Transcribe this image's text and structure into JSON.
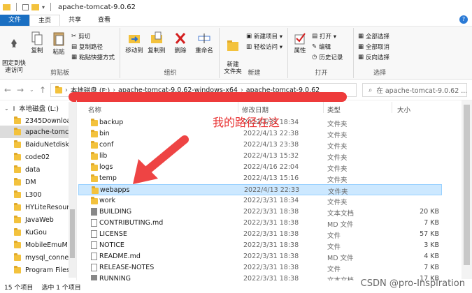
{
  "window": {
    "title": "apache-tomcat-9.0.62"
  },
  "menu": {
    "tabs": [
      "文件",
      "主页",
      "共享",
      "查看"
    ]
  },
  "ribbon": {
    "clipboard": {
      "pin": "固定到快\n速访问",
      "copy": "复制",
      "paste": "粘贴",
      "cut": "剪切",
      "copy_path": "复制路径",
      "paste_shortcut": "粘贴快捷方式",
      "label": "剪贴板"
    },
    "organize": {
      "move_to": "移动到",
      "copy_to": "复制到",
      "delete": "删除",
      "rename": "重命名",
      "label": "组织"
    },
    "new": {
      "new_folder": "新建\n文件夹",
      "new_item": "新建项目 ▾",
      "easy_access": "轻松访问 ▾",
      "label": "新建"
    },
    "open": {
      "properties": "属性",
      "open": "打开 ▾",
      "edit": "编辑",
      "history": "历史记录",
      "label": "打开"
    },
    "select": {
      "select_all": "全部选择",
      "select_none": "全部取消",
      "invert": "反向选择",
      "label": "选择"
    }
  },
  "address": {
    "crumbs": [
      "本地磁盘 (F:)",
      "apache-tomcat-9.0.62-windows-x64",
      "apache-tomcat-9.0.62"
    ],
    "search_placeholder": "在 apache-tomcat-9.0.62 ..."
  },
  "sidebar": {
    "drive": "本地磁盘 (L:)",
    "items": [
      "2345Downloa",
      "apache-tomc",
      "BaiduNetdisk",
      "code02",
      "data",
      "DM",
      "L300",
      "HYLiteResour",
      "JavaWeb",
      "KuGou",
      "MobileEmuM",
      "mysql_connec",
      "Program Files"
    ]
  },
  "columns": {
    "name": "名称",
    "date": "修改日期",
    "type": "类型",
    "size": "大小"
  },
  "files": [
    {
      "name": "backup",
      "date": "2022/3/31 18:34",
      "type": "文件夹",
      "size": "",
      "kind": "folder"
    },
    {
      "name": "bin",
      "date": "2022/4/13 22:38",
      "type": "文件夹",
      "size": "",
      "kind": "folder"
    },
    {
      "name": "conf",
      "date": "2022/4/13 23:38",
      "type": "文件夹",
      "size": "",
      "kind": "folder"
    },
    {
      "name": "lib",
      "date": "2022/4/13 15:32",
      "type": "文件夹",
      "size": "",
      "kind": "folder"
    },
    {
      "name": "logs",
      "date": "2022/4/16 22:04",
      "type": "文件夹",
      "size": "",
      "kind": "folder"
    },
    {
      "name": "temp",
      "date": "2022/4/13 15:16",
      "type": "文件夹",
      "size": "",
      "kind": "folder"
    },
    {
      "name": "webapps",
      "date": "2022/4/13 22:33",
      "type": "文件夹",
      "size": "",
      "kind": "folder"
    },
    {
      "name": "work",
      "date": "2022/3/31 18:34",
      "type": "文件夹",
      "size": "",
      "kind": "folder"
    },
    {
      "name": "BUILDING",
      "date": "2022/3/31 18:38",
      "type": "文本文档",
      "size": "20 KB",
      "kind": "file-dark"
    },
    {
      "name": "CONTRIBUTING.md",
      "date": "2022/3/31 18:38",
      "type": "MD 文件",
      "size": "7 KB",
      "kind": "file"
    },
    {
      "name": "LICENSE",
      "date": "2022/3/31 18:38",
      "type": "文件",
      "size": "57 KB",
      "kind": "file"
    },
    {
      "name": "NOTICE",
      "date": "2022/3/31 18:38",
      "type": "文件",
      "size": "3 KB",
      "kind": "file"
    },
    {
      "name": "README.md",
      "date": "2022/3/31 18:38",
      "type": "MD 文件",
      "size": "4 KB",
      "kind": "file"
    },
    {
      "name": "RELEASE-NOTES",
      "date": "2022/3/31 18:38",
      "type": "文件",
      "size": "7 KB",
      "kind": "file"
    },
    {
      "name": "RUNNING",
      "date": "2022/3/31 18:38",
      "type": "文本文档",
      "size": "17 KB",
      "kind": "file-dark"
    }
  ],
  "status": {
    "count": "15 个项目",
    "selected": "选中 1 个项目"
  },
  "annotation": "我的路径在这",
  "watermark": "CSDN @pro-Inspiration",
  "colors": {
    "annotation": "#e83232",
    "selection": "#cce8ff",
    "accent": "#1a6fc2",
    "folder": "#f3c23d"
  }
}
